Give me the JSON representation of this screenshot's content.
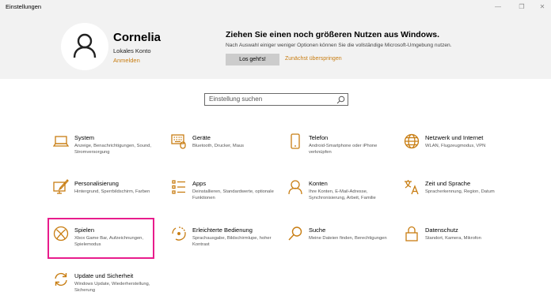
{
  "window": {
    "title": "Einstellungen",
    "min_glyph": "—",
    "max_glyph": "❐",
    "close_glyph": "✕"
  },
  "account": {
    "name": "Cornelia",
    "type": "Lokales Konto",
    "signin": "Anmelden"
  },
  "promo": {
    "title": "Ziehen Sie einen noch größeren Nutzen aus Windows.",
    "text": "Nach Auswahl einiger weniger Optionen können Sie die vollständige Microsoft-Umgebung nutzen.",
    "button": "Los geht's!",
    "skip": "Zunächst überspringen"
  },
  "search": {
    "placeholder": "Einstellung suchen"
  },
  "accent": "#c87d12",
  "highlight_color": "#e81c8c",
  "tiles": [
    {
      "icon": "laptop-icon",
      "name": "System",
      "desc": "Anzeige, Benachrichtigungen, Sound, Stromversorgung"
    },
    {
      "icon": "keyboard-icon",
      "name": "Geräte",
      "desc": "Bluetooth, Drucker, Maus"
    },
    {
      "icon": "phone-icon",
      "name": "Telefon",
      "desc": "Android-Smartphone oder iPhone verknüpfen"
    },
    {
      "icon": "globe-icon",
      "name": "Netzwerk und Internet",
      "desc": "WLAN, Flugzeugmodus, VPN"
    },
    {
      "icon": "paint-icon",
      "name": "Personalisierung",
      "desc": "Hintergrund, Sperrbildschirm, Farben"
    },
    {
      "icon": "apps-list-icon",
      "name": "Apps",
      "desc": "Deinstallieren, Standardwerte, optionale Funktionen"
    },
    {
      "icon": "person-icon",
      "name": "Konten",
      "desc": "Ihre Konten, E-Mail-Adresse, Synchronisierung, Arbeit, Familie"
    },
    {
      "icon": "language-icon",
      "name": "Zeit und Sprache",
      "desc": "Spracherkennung, Region, Datum"
    },
    {
      "icon": "xbox-icon",
      "name": "Spielen",
      "desc": "Xbox Game Bar, Aufzeichnungen, Spielemodus"
    },
    {
      "icon": "accessibility-icon",
      "name": "Erleichterte Bedienung",
      "desc": "Sprachausgabe, Bildschirmlupe, hoher Kontrast"
    },
    {
      "icon": "search-icon",
      "name": "Suche",
      "desc": "Meine Dateien finden, Berechtigungen"
    },
    {
      "icon": "lock-icon",
      "name": "Datenschutz",
      "desc": "Standort, Kamera, Mikrofon"
    },
    {
      "icon": "sync-icon",
      "name": "Update und Sicherheit",
      "desc": "Windows Update, Wiederherstellung, Sicherung"
    }
  ]
}
